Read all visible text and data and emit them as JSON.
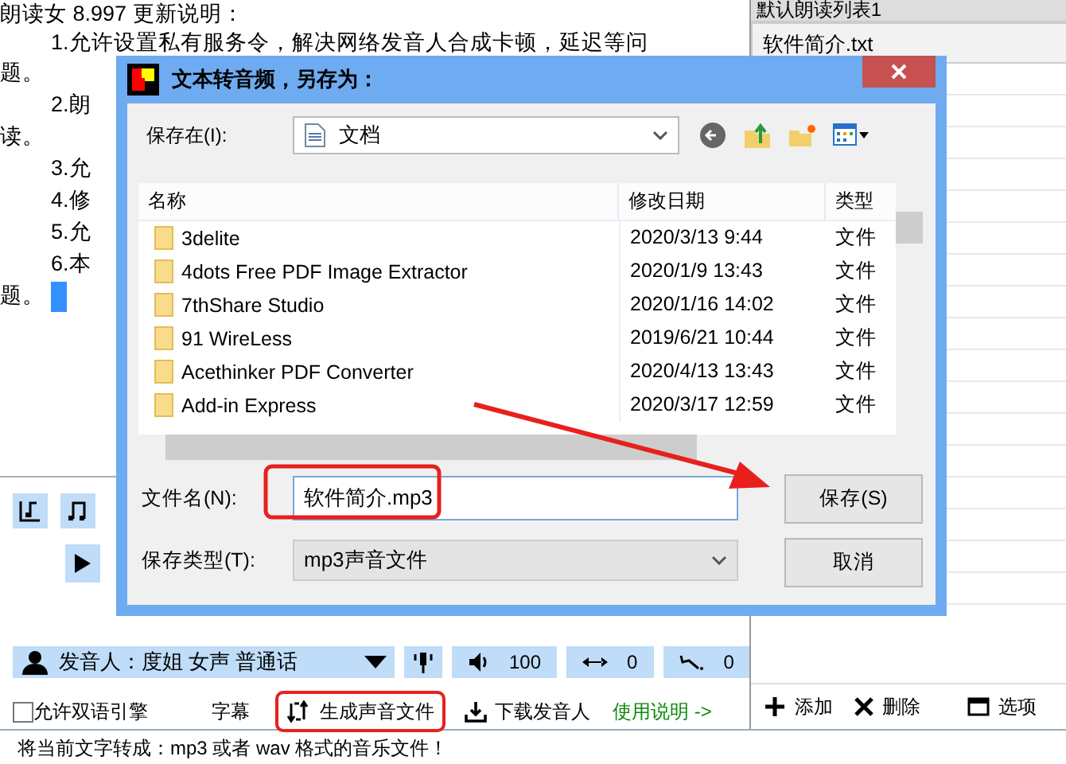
{
  "editor": {
    "lines": [
      {
        "text": "朗读女 8.997 更新说明：",
        "indent": false
      },
      {
        "text": "1.允许设置私有服务令，解决网络发音人合成卡顿，延迟等问",
        "indent": true
      },
      {
        "text": "题。",
        "indent": false
      },
      {
        "text": "2.朗",
        "indent": true
      },
      {
        "text": "读。",
        "indent": false
      },
      {
        "text": "3.允",
        "indent": true
      },
      {
        "text": "4.修",
        "indent": true
      },
      {
        "text": "5.允",
        "indent": true
      },
      {
        "text": "6.本",
        "indent": true
      },
      {
        "text": "题。",
        "indent": false
      }
    ]
  },
  "right_panel": {
    "list_dropdown": "默认朗读列表1",
    "items": [
      {
        "label": "软件简介.txt",
        "selected": true
      }
    ],
    "buttons": [
      {
        "kind": "add",
        "label": "添加"
      },
      {
        "kind": "delete",
        "label": "删除"
      },
      {
        "kind": "options",
        "label": "选项"
      }
    ]
  },
  "voice_bar": {
    "voice": "发音人：度姐 女声 普通话",
    "volume": "100",
    "speed": "0",
    "pitch": "0"
  },
  "options_row": {
    "bilingual": {
      "label": "允许双语引擎",
      "checked": false
    },
    "subtitle": "字幕",
    "generate": "生成声音文件",
    "download": "下载发音人",
    "help": "使用说明 ->"
  },
  "status_bar": "将当前文字转成：mp3 或者 wav 格式的音乐文件！",
  "dialog": {
    "title": "文本转音频，另存为：",
    "save_in_label": "保存在(I):",
    "save_in": "文档",
    "columns": [
      "名称",
      "修改日期",
      "类型"
    ],
    "files": [
      {
        "name": "3delite",
        "date": "2020/3/13 9:44",
        "type": "文件"
      },
      {
        "name": "4dots Free PDF Image Extractor",
        "date": "2020/1/9 13:43",
        "type": "文件"
      },
      {
        "name": "7thShare Studio",
        "date": "2020/1/16 14:02",
        "type": "文件"
      },
      {
        "name": "91 WireLess",
        "date": "2019/6/21 10:44",
        "type": "文件"
      },
      {
        "name": "Acethinker PDF Converter",
        "date": "2020/4/13 13:43",
        "type": "文件"
      },
      {
        "name": "Add-in Express",
        "date": "2020/3/17 12:59",
        "type": "文件"
      }
    ],
    "filename_label": "文件名(N):",
    "filename": "软件简介.mp3",
    "type_label": "保存类型(T):",
    "filetype": "mp3声音文件",
    "save": "保存(S)",
    "cancel": "取消"
  }
}
